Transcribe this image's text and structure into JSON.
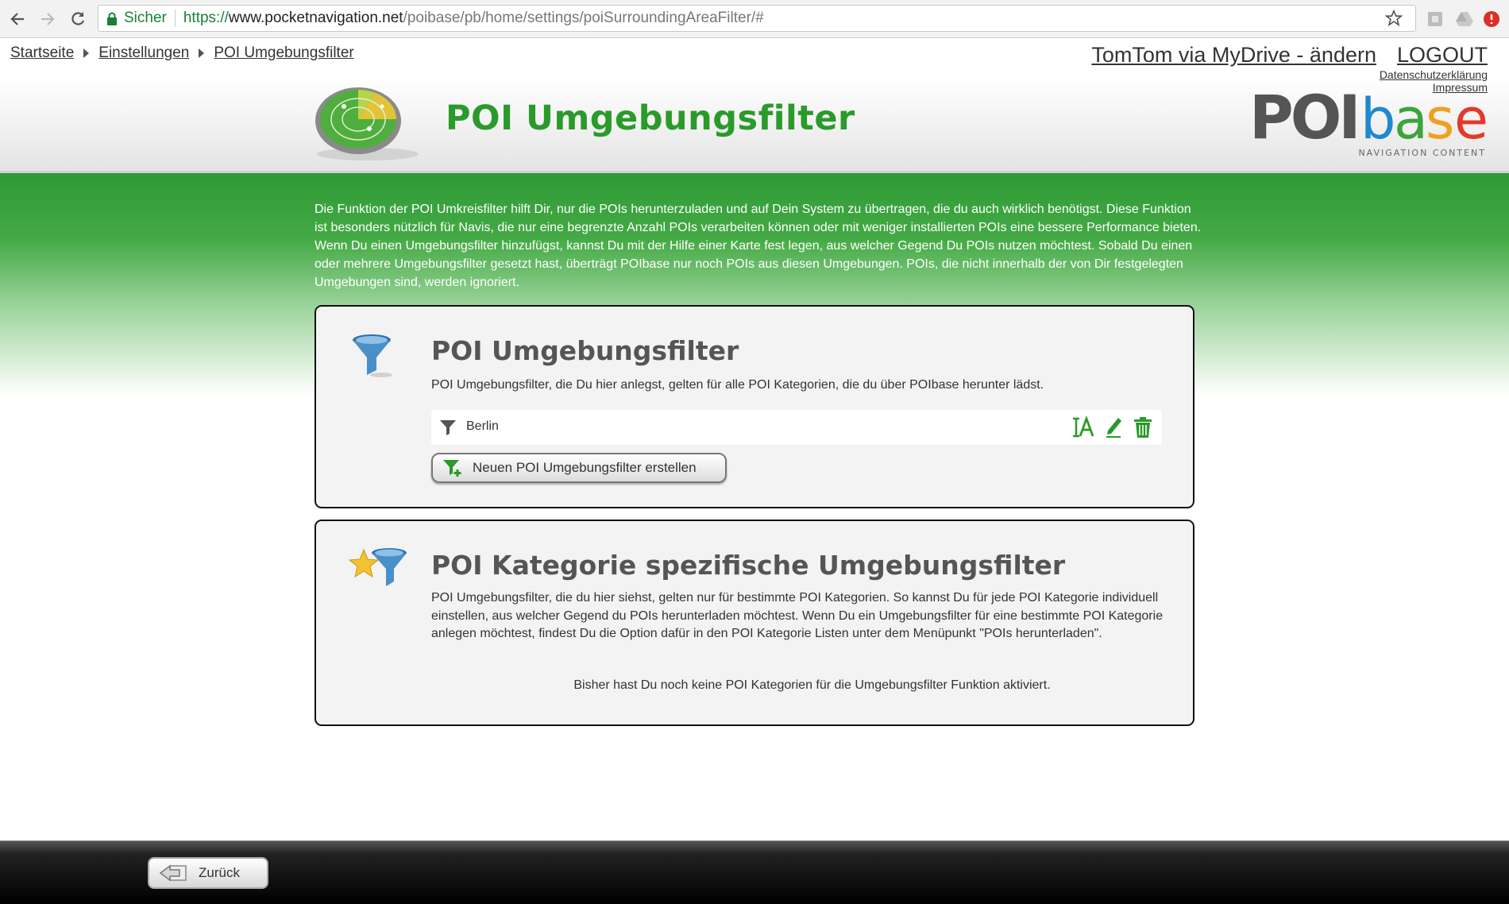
{
  "browser": {
    "secure_label": "Sicher",
    "url_scheme": "https://",
    "url_host": "www.pocketnavigation.net",
    "url_path": "/poibase/pb/home/settings/poiSurroundingAreaFilter/#"
  },
  "breadcrumb": {
    "items": [
      "Startseite",
      "Einstellungen",
      "POI Umgebungsfilter"
    ]
  },
  "account": {
    "device_label": "TomTom via MyDrive - ändern",
    "logout_label": "LOGOUT",
    "privacy_label": "Datenschutzerklärung",
    "imprint_label": "Impressum"
  },
  "logo": {
    "part1": "POI",
    "part2_letters": [
      "b",
      "a",
      "s",
      "e"
    ],
    "tagline": "NAVIGATION CONTENT"
  },
  "page": {
    "title": "POI Umgebungsfilter",
    "intro": "Die Funktion der POI Umkreisfilter hilft Dir, nur die POIs herunterzuladen und auf Dein System zu übertragen, die du auch wirklich benötigst. Diese Funktion ist besonders nützlich für Navis, die nur eine begrenzte Anzahl POIs verarbeiten können oder mit weniger installierten POIs eine bessere Performance bieten. Wenn Du einen Umgebungsfilter hinzufügst, kannst Du mit der Hilfe einer Karte fest legen, aus welcher Gegend Du POIs nutzen möchtest. Sobald Du einen oder mehrere Umgebungsfilter gesetzt hast, überträgt POIbase nur noch POIs aus diesen Umgebungen. POIs, die nicht innerhalb der von Dir festgelegten Umgebungen sind, werden ignoriert."
  },
  "general_filters": {
    "title": "POI Umgebungsfilter",
    "description": "POI Umgebungsfilter, die Du hier anlegst, gelten für alle POI Kategorien, die du über POIbase herunter lädst.",
    "filters": [
      {
        "name": "Berlin"
      }
    ],
    "new_button_label": "Neuen POI Umgebungsfilter erstellen"
  },
  "category_filters": {
    "title": "POI Kategorie spezifische Umgebungsfilter",
    "description": "POI Umgebungsfilter, die du hier siehst, gelten nur für bestimmte POI Kategorien. So kannst Du für jede POI Kategorie individuell einstellen, aus welcher Gegend du POIs herunterladen möchtest. Wenn Du ein Umgebungsfilter für eine bestimmte POI Kategorie anlegen möchtest, findest Du die Option dafür in den POI Kategorie Listen unter dem Menüpunkt \"POIs herunterladen\".",
    "empty_note": "Bisher hast Du noch keine POI Kategorien für die Umgebungsfilter Funktion aktiviert."
  },
  "footer": {
    "back_label": "Zurück"
  },
  "colors": {
    "brand_green": "#2a9a2a",
    "band_green": "#2e9a35",
    "logo_gray": "#555555",
    "logo_b": "#1e88d0",
    "logo_a": "#3aa53a",
    "logo_s": "#f0a020",
    "logo_e": "#e23a2a"
  }
}
